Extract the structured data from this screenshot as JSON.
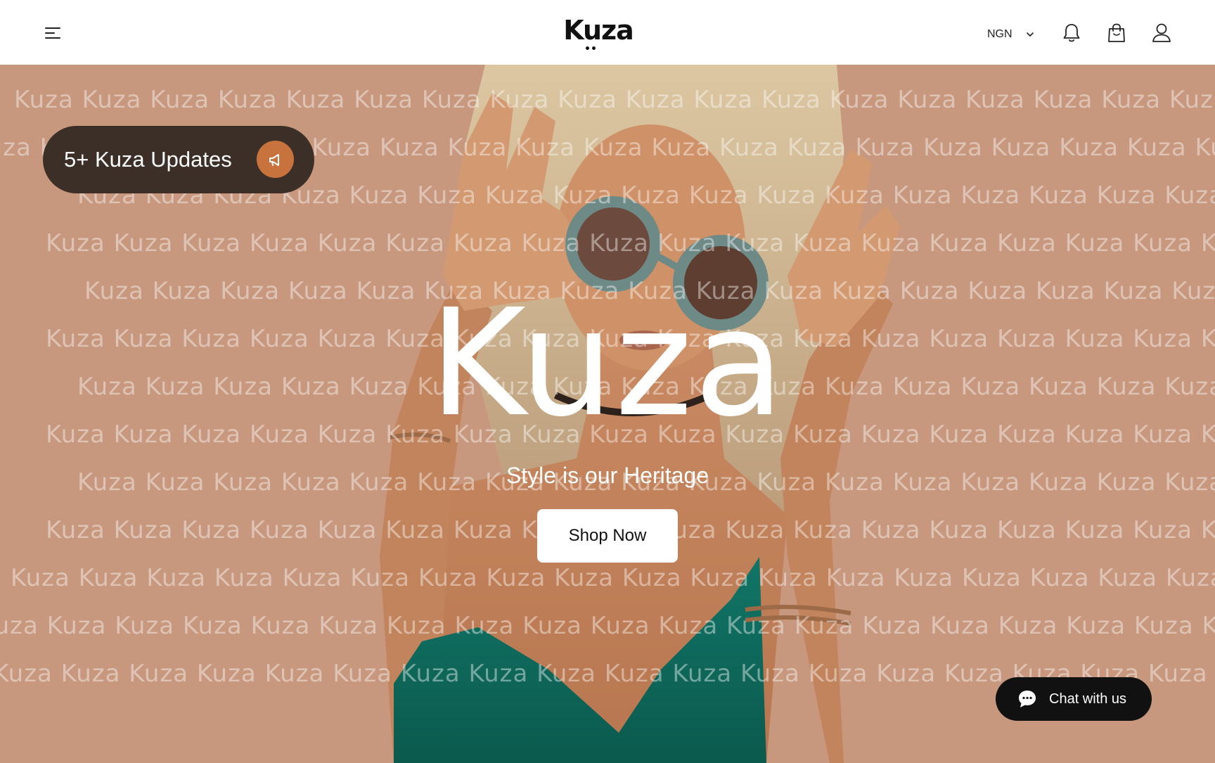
{
  "header": {
    "menu_icon": "hamburger-menu-icon",
    "logo_text": "Kuza",
    "currency": "NGN",
    "icons": [
      "bell-icon",
      "shopping-bag-icon",
      "user-icon"
    ]
  },
  "hero": {
    "pattern_word": "Kuza",
    "updates_label": "5+ Kuza Updates",
    "updates_icon": "megaphone-icon",
    "title": "Kuza",
    "subtitle": "Style is our Heritage",
    "cta_label": "Shop Now"
  },
  "chat": {
    "label": "Chat with us",
    "icon": "chat-bubble-icon"
  },
  "colors": {
    "hero_background": "#c7987e",
    "pill_background": "#3c2f28",
    "pill_badge": "#c8723e",
    "top_green": "#0f6e63",
    "chat_background": "#111111"
  }
}
